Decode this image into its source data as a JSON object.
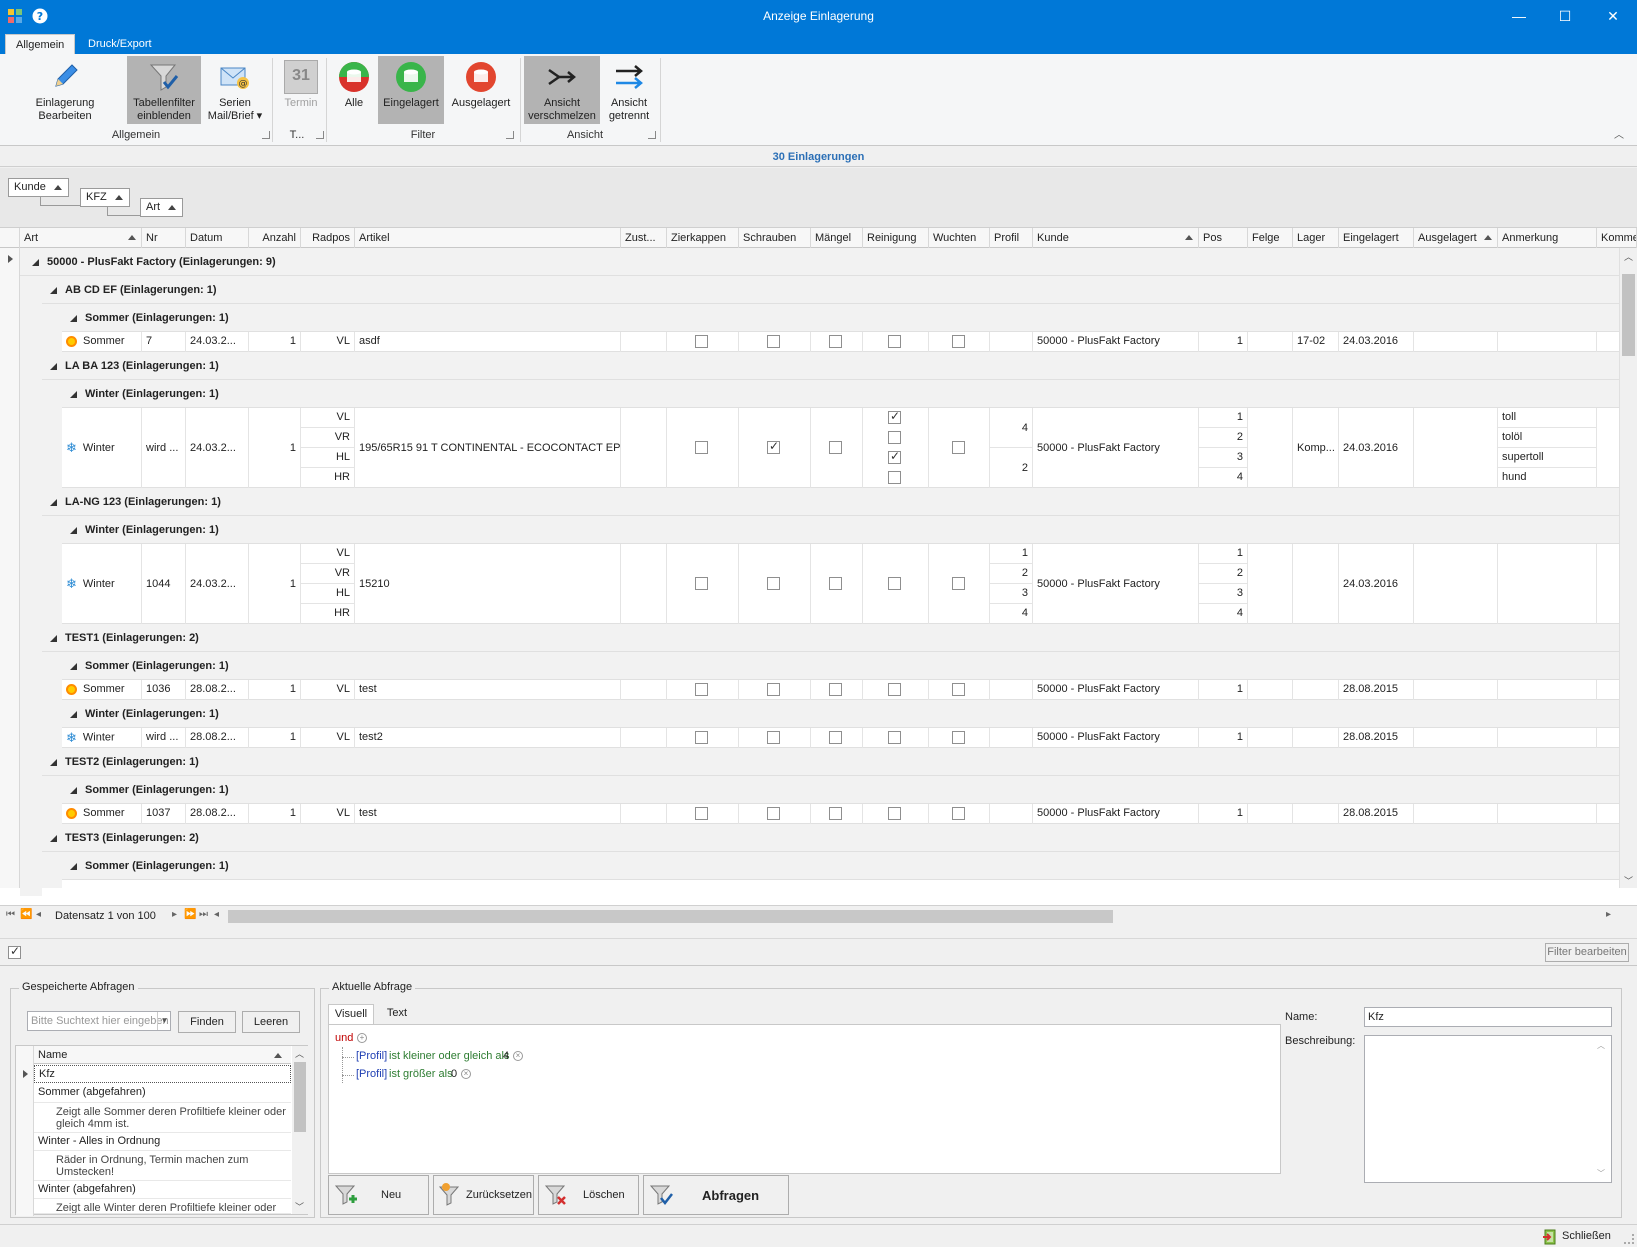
{
  "window": {
    "title": "Anzeige Einlagerung",
    "minimize": "—",
    "maximize": "☐",
    "close": "✕"
  },
  "tabs": [
    {
      "label": "Allgemein",
      "active": true
    },
    {
      "label": "Druck/Export",
      "active": false
    }
  ],
  "ribbon": {
    "buttons": {
      "edit": "Einlagerung\nBearbeiten",
      "tablefilter": "Tabellenfilter\neinblenden",
      "serien": "Serien\nMail/Brief ▾",
      "termin": "Termin",
      "termin_day": "31",
      "alle": "Alle",
      "eingelagert": "Eingelagert",
      "ausgelagert": "Ausgelagert",
      "merge": "Ansicht\nverschmelzen",
      "split": "Ansicht\ngetrennt"
    },
    "groups": {
      "allgemein": "Allgemein",
      "termin": "T...",
      "filter": "Filter",
      "ansicht": "Ansicht"
    }
  },
  "count_label": "30 Einlagerungen",
  "group_by": [
    "Kunde",
    "KFZ",
    "Art"
  ],
  "columns": [
    "Art",
    "Nr",
    "Datum",
    "Anzahl",
    "Radpos",
    "Artikel",
    "Zust...",
    "Zierkappen",
    "Schrauben",
    "Mängel",
    "Reinigung",
    "Wuchten",
    "Profil",
    "Kunde",
    "Pos",
    "Felge",
    "Lager",
    "Eingelagert",
    "Ausgelagert",
    "Anmerkung",
    "Komme"
  ],
  "groups": {
    "customer": "50000 - PlusFakt Factory  (Einlagerungen: 9)",
    "abcdef": "AB CD EF (Einlagerungen: 1)",
    "abcdef_sommer": "Sommer (Einlagerungen: 1)",
    "laba": "LA BA 123 (Einlagerungen: 1)",
    "laba_winter": "Winter (Einlagerungen: 1)",
    "lang": "LA-NG 123 (Einlagerungen: 1)",
    "lang_winter": "Winter (Einlagerungen: 1)",
    "test1": "TEST1 (Einlagerungen: 2)",
    "test1_sommer": "Sommer (Einlagerungen: 1)",
    "test1_winter": "Winter (Einlagerungen: 1)",
    "test2": "TEST2 (Einlagerungen: 1)",
    "test2_sommer": "Sommer (Einlagerungen: 1)",
    "test3": "TEST3 (Einlagerungen: 2)",
    "test3_sommer": "Sommer (Einlagerungen: 1)"
  },
  "rows": {
    "r1": {
      "art": "Sommer",
      "nr": "7",
      "datum": "24.03.2...",
      "anzahl": "1",
      "radpos": "VL",
      "artikel": "asdf",
      "kunde": "50000 - PlusFakt Factory",
      "pos": "1",
      "lager": "17-02",
      "eingelagert": "24.03.2016"
    },
    "r2": {
      "art": "Winter",
      "nr": "wird ...",
      "datum": "24.03.2...",
      "anzahl": "1",
      "radpos": [
        "VL",
        "VR",
        "HL",
        "HR"
      ],
      "artikel": "195/65R15 91 T CONTINENTAL - ECOCONTACT EP...",
      "profil": [
        "4",
        "2"
      ],
      "kunde": "50000 - PlusFakt Factory",
      "pos": [
        "1",
        "2",
        "3",
        "4"
      ],
      "lager": "Komp...",
      "eingelagert": "24.03.2016",
      "anmerkung": [
        "toll",
        "tolöl",
        "supertoll",
        "hund"
      ]
    },
    "r3": {
      "art": "Winter",
      "nr": "1044",
      "datum": "24.03.2...",
      "anzahl": "1",
      "radpos": [
        "VL",
        "VR",
        "HL",
        "HR"
      ],
      "artikel": "15210",
      "profil": [
        "1",
        "2",
        "3",
        "4"
      ],
      "kunde": "50000 - PlusFakt Factory",
      "pos": [
        "1",
        "2",
        "3",
        "4"
      ],
      "eingelagert": "24.03.2016"
    },
    "r4": {
      "art": "Sommer",
      "nr": "1036",
      "datum": "28.08.2...",
      "anzahl": "1",
      "radpos": "VL",
      "artikel": "test",
      "kunde": "50000 - PlusFakt Factory",
      "pos": "1",
      "eingelagert": "28.08.2015"
    },
    "r5": {
      "art": "Winter",
      "nr": "wird ...",
      "datum": "28.08.2...",
      "anzahl": "1",
      "radpos": "VL",
      "artikel": "test2",
      "kunde": "50000 - PlusFakt Factory",
      "pos": "1",
      "eingelagert": "28.08.2015"
    },
    "r6": {
      "art": "Sommer",
      "nr": "1037",
      "datum": "28.08.2...",
      "anzahl": "1",
      "radpos": "VL",
      "artikel": "test",
      "kunde": "50000 - PlusFakt Factory",
      "pos": "1",
      "eingelagert": "28.08.2015"
    }
  },
  "navigator": {
    "record": "Datensatz 1 von 100"
  },
  "filter_edit": "Filter bearbeiten",
  "saved": {
    "legend": "Gespeicherte Abfragen",
    "search_placeholder": "Bitte Suchtext hier eingeben",
    "find": "Finden",
    "clear": "Leeren",
    "col_name": "Name",
    "items": [
      {
        "name": "Kfz",
        "desc": ""
      },
      {
        "name": "Sommer (abgefahren)",
        "desc": "Zeigt alle Sommer deren Profiltiefe kleiner oder gleich 4mm ist."
      },
      {
        "name": "Winter - Alles in Ordnung",
        "desc": "Räder in Ordnung, Termin machen zum Umstecken!"
      },
      {
        "name": "Winter (abgefahren)",
        "desc": "Zeigt alle Winter deren Profiltiefe kleiner oder"
      }
    ]
  },
  "current": {
    "legend": "Aktuelle Abfrage",
    "tab_visual": "Visuell",
    "tab_text": "Text",
    "op": "und",
    "cond1_field": "[Profil]",
    "cond1_op": "ist kleiner oder gleich als",
    "cond1_val": "4",
    "cond2_field": "[Profil]",
    "cond2_op": "ist größer als",
    "cond2_val": "0",
    "name_label": "Name:",
    "name_value": "Kfz",
    "desc_label": "Beschreibung:",
    "btn_new": "Neu",
    "btn_reset": "Zurücksetzen",
    "btn_delete": "Löschen",
    "btn_query": "Abfragen"
  },
  "status": {
    "close": "Schließen"
  },
  "colors": {
    "titlebar": "#0078d7",
    "accent": "#2b6fb6",
    "checked": "#b3b3b3"
  }
}
